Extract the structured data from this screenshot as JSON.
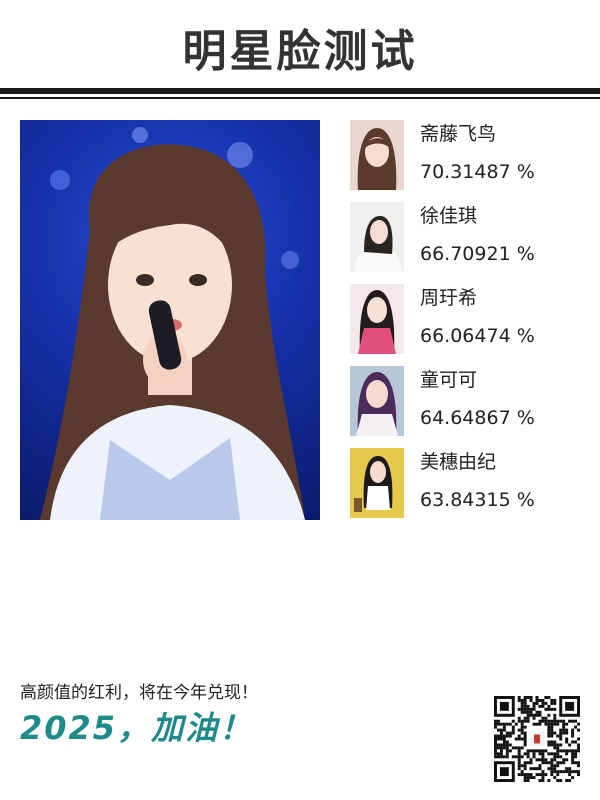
{
  "header": {
    "title": "明星脸测试"
  },
  "main_photo": {
    "alt": "uploaded-face-photo"
  },
  "matches": [
    {
      "name": "斋藤飞鸟",
      "score": "70.31487 %",
      "thumb_bg": "#e8d6cf"
    },
    {
      "name": "徐佳琪",
      "score": "66.70921 %",
      "thumb_bg": "#efefef"
    },
    {
      "name": "周玗希",
      "score": "66.06474 %",
      "thumb_bg": "#f3e9ec"
    },
    {
      "name": "童可可",
      "score": "64.64867 %",
      "thumb_bg": "#b7c7d8"
    },
    {
      "name": "美穗由纪",
      "score": "63.84315 %",
      "thumb_bg": "#e6c84a"
    }
  ],
  "footer": {
    "slogan": "高颜值的红利，将在今年兑现！",
    "cheer": "2025，加油！",
    "cheer_color": "#1f8a8a"
  },
  "qr": {
    "icon": "qr-code-icon"
  }
}
